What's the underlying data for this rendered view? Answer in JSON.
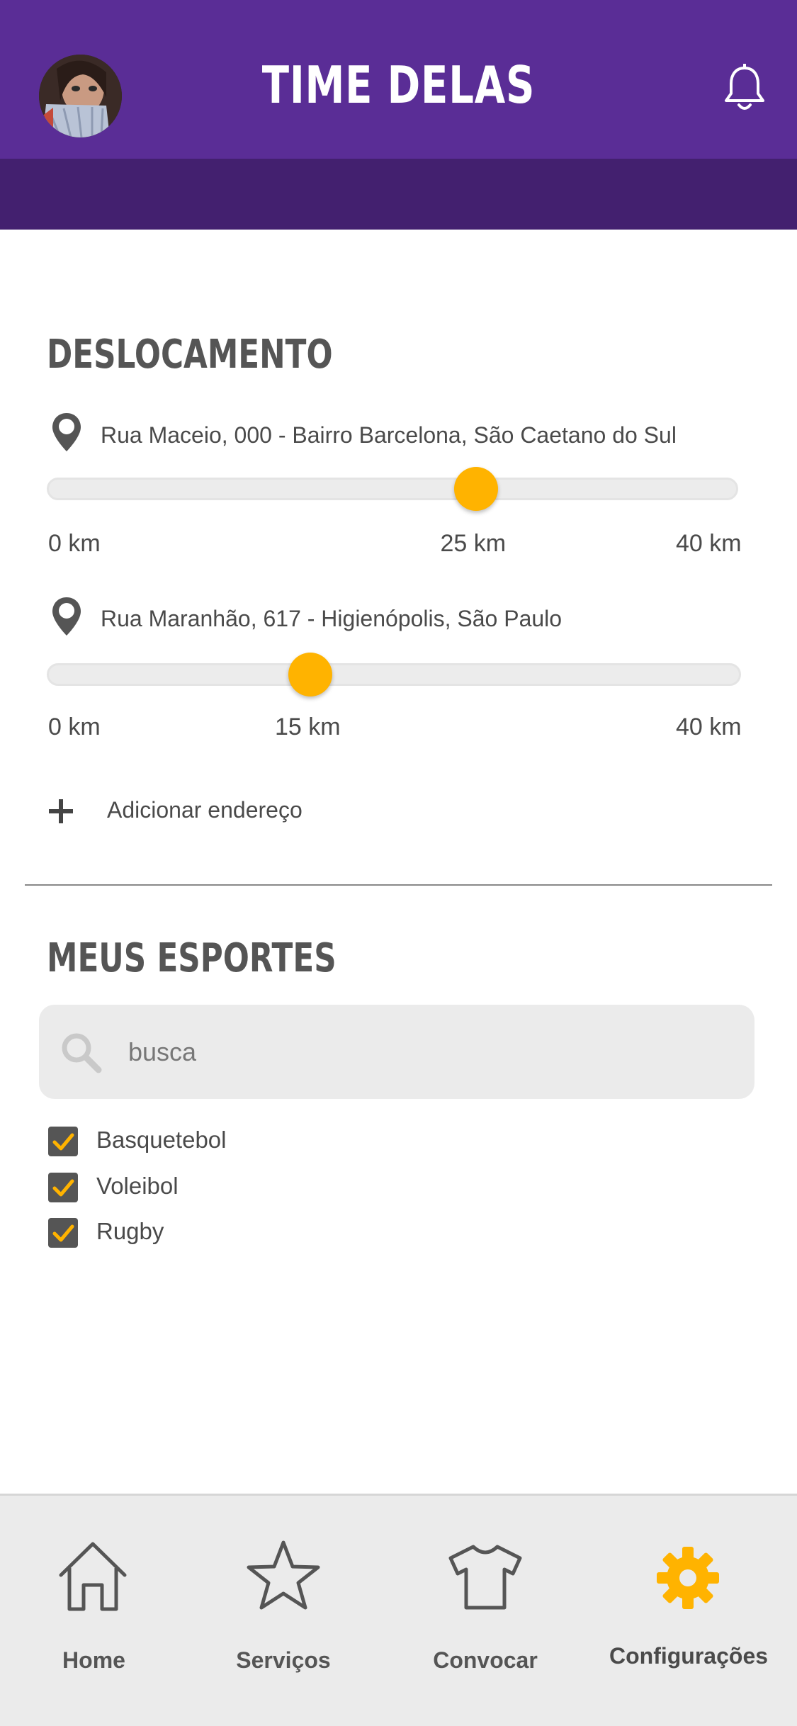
{
  "header": {
    "title": "TIME DELAS",
    "avatar_icon": "user-avatar",
    "bell_icon": "bell-icon",
    "background": "#5a2d96"
  },
  "deslocamento": {
    "title": "DESLOCAMENTO",
    "addresses": [
      {
        "text": "Rua Maceio, 000 - Bairro Barcelona, São Caetano do Sul",
        "min_label": "0 km",
        "value_label": "25 km",
        "max_label": "40 km",
        "min": 0,
        "max": 40,
        "value": 25
      },
      {
        "text": "Rua Maranhão, 617 - Higienópolis, São Paulo",
        "min_label": "0 km",
        "value_label": "15 km",
        "max_label": "40 km",
        "min": 0,
        "max": 40,
        "value": 15
      }
    ],
    "add_label": "Adicionar endereço"
  },
  "esportes": {
    "title": "MEUS ESPORTES",
    "search_placeholder": "busca",
    "items": [
      {
        "label": "Basquetebol",
        "checked": true
      },
      {
        "label": "Voleibol",
        "checked": true
      },
      {
        "label": "Rugby",
        "checked": true
      }
    ]
  },
  "tabbar": {
    "tabs": [
      {
        "label": "Home",
        "icon": "home-icon"
      },
      {
        "label": "Serviços",
        "icon": "star-icon"
      },
      {
        "label": "Convocar",
        "icon": "shirt-icon"
      },
      {
        "label": "Configurações",
        "icon": "gear-icon",
        "active": true
      }
    ]
  },
  "colors": {
    "accent": "#ffb300",
    "purple": "#5a2d96",
    "purple_dark": "#43206f"
  }
}
